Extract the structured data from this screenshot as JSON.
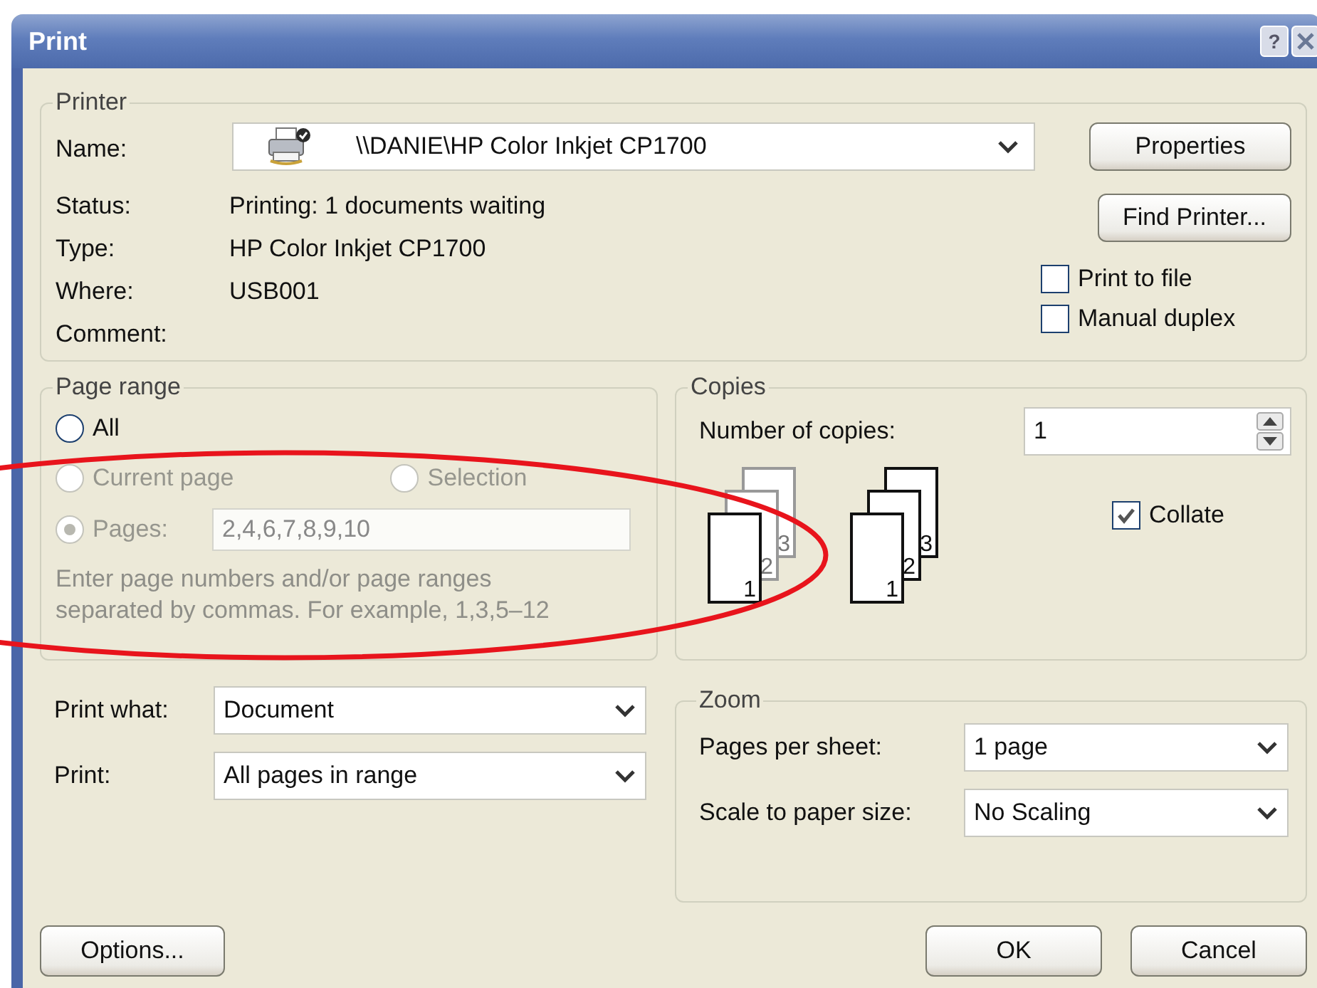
{
  "window": {
    "title": "Print",
    "help_button": "?"
  },
  "printer": {
    "legend": "Printer",
    "name_label": "Name:",
    "name_value": "\\\\DANIE\\HP Color Inkjet CP1700",
    "info": [
      {
        "label": "Status:",
        "value": "Printing: 1 documents waiting"
      },
      {
        "label": "Type:",
        "value": "HP Color Inkjet CP1700"
      },
      {
        "label": "Where:",
        "value": "USB001"
      },
      {
        "label": "Comment:"
      }
    ],
    "buttons": [
      "Properties",
      "Find Printer..."
    ],
    "options": [
      {
        "label": "Print to file",
        "checked": false
      },
      {
        "label": "Manual duplex",
        "checked": false
      }
    ]
  },
  "page_range": {
    "legend": "Page range",
    "radios": [
      {
        "label": "All",
        "selected": false,
        "disabled": false
      },
      {
        "label": "Current page",
        "selected": false,
        "disabled": true
      },
      {
        "label": "Selection",
        "selected": false,
        "disabled": true
      },
      {
        "label": "Pages:",
        "selected": true,
        "disabled": true
      }
    ],
    "pages_value": "2,4,6,7,8,9,10",
    "pages_disabled": true,
    "hint": "Enter page numbers and/or page ranges separated by commas.  For example, 1,3,5–12"
  },
  "copies": {
    "legend": "Copies",
    "label": "Number of copies:",
    "value": "1",
    "stacks": [
      {
        "pages": [
          "1",
          "2",
          "3"
        ],
        "disabled": true
      },
      {
        "pages": [
          "1",
          "2",
          "3"
        ],
        "disabled": false
      }
    ],
    "collate": {
      "label": "Collate",
      "checked": true
    }
  },
  "print_what": [
    {
      "label": "Print what:",
      "value": "Document"
    },
    {
      "label": "Print:",
      "value": "All pages in range"
    }
  ],
  "zoom": {
    "legend": "Zoom",
    "rows": [
      {
        "label": "Pages per sheet:",
        "value": "1 page"
      },
      {
        "label": "Scale to paper size:",
        "value": "No Scaling"
      }
    ]
  },
  "footer": {
    "options_button": "Options...",
    "buttons": [
      "OK",
      "Cancel"
    ]
  },
  "annotation": {
    "kind": "ellipse",
    "color": "#e8141c"
  }
}
